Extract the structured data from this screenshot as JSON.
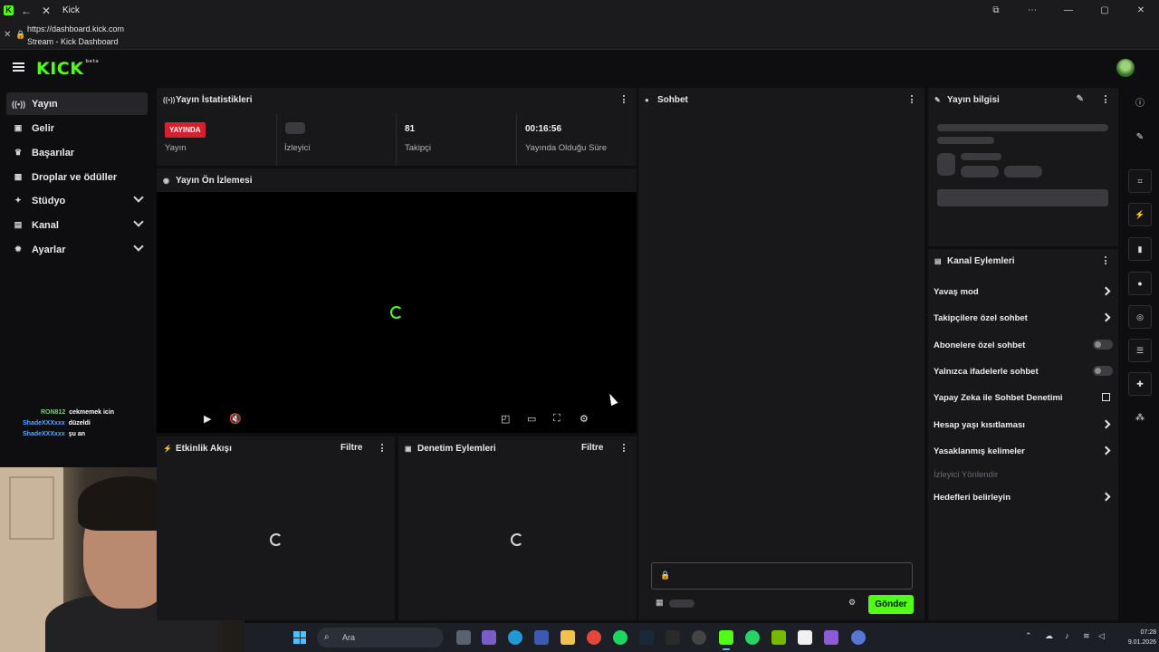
{
  "browser": {
    "tab_title": "Kick",
    "favicon": "K",
    "url": "https://dashboard.kick.com",
    "page_title": "Stream - Kick Dashboard"
  },
  "header": {
    "logo": "KICK",
    "logo_sup": "beta"
  },
  "sidebar": {
    "items": [
      {
        "label": "Yayın",
        "icon": "broadcast-icon",
        "glyph": "((•))",
        "active": true
      },
      {
        "label": "Gelir",
        "icon": "wallet-icon",
        "glyph": "▣"
      },
      {
        "label": "Başarılar",
        "icon": "trophy-icon",
        "glyph": "♛"
      },
      {
        "label": "Droplar ve ödüller",
        "icon": "gift-icon",
        "glyph": "▦"
      },
      {
        "label": "Stüdyo",
        "icon": "studio-icon",
        "glyph": "✦",
        "expandable": true
      },
      {
        "label": "Kanal",
        "icon": "channel-icon",
        "glyph": "▤",
        "expandable": true
      },
      {
        "label": "Ayarlar",
        "icon": "gear-icon",
        "glyph": "✹",
        "expandable": true
      }
    ]
  },
  "stats": {
    "title": "Yayın İstatistikleri",
    "live_badge": "YAYINDA",
    "items": [
      {
        "value": "",
        "label": "Yayın"
      },
      {
        "value": "",
        "label": "İzleyici"
      },
      {
        "value": "81",
        "label": "Takipçi"
      },
      {
        "value": "00:16:56",
        "label": "Yayında Olduğu Süre"
      }
    ]
  },
  "preview": {
    "title": "Yayın Ön İzlemesi"
  },
  "activity": {
    "title": "Etkinlik Akışı",
    "filter": "Filtre"
  },
  "moderation": {
    "title": "Denetim Eylemleri",
    "filter": "Filtre"
  },
  "chat": {
    "title": "Sohbet",
    "send": "Gönder"
  },
  "stream_info": {
    "title": "Yayın bilgisi"
  },
  "channel_actions": {
    "title": "Kanal Eylemleri",
    "items": [
      {
        "label": "Yavaş mod",
        "type": "chevron"
      },
      {
        "label": "Takipçilere özel sohbet",
        "type": "chevron"
      },
      {
        "label": "Abonelere özel sohbet",
        "type": "toggle",
        "on": false
      },
      {
        "label": "Yalnızca ifadelerle sohbet",
        "type": "toggle",
        "on": false
      },
      {
        "label": "Yapay Zeka ile Sohbet Denetimi",
        "type": "external"
      },
      {
        "label": "Hesap yaşı kısıtlaması",
        "type": "chevron"
      },
      {
        "label": "Yasaklanmış kelimeler",
        "type": "chevron"
      },
      {
        "label": "İzleyici Yönlendir",
        "type": "muted"
      },
      {
        "label": "Hedefleri belirleyin",
        "type": "chevron"
      }
    ]
  },
  "overlay_chat": [
    {
      "user": "RON812",
      "msg": "cekmemek icin",
      "color": "#78d36b"
    },
    {
      "user": "ShadeXXXxxx",
      "msg": "düzeldi",
      "color": "#5aa6ff"
    },
    {
      "user": "ShadeXXXxxx",
      "msg": "şu an",
      "color": "#5aa6ff"
    }
  ],
  "taskbar": {
    "search": "Ara",
    "time": "07:28",
    "date": "9.01.2026"
  },
  "colors": {
    "accent": "#53fc18",
    "live": "#d6202d",
    "panel": "#18181b",
    "background": "#0e0e10"
  }
}
